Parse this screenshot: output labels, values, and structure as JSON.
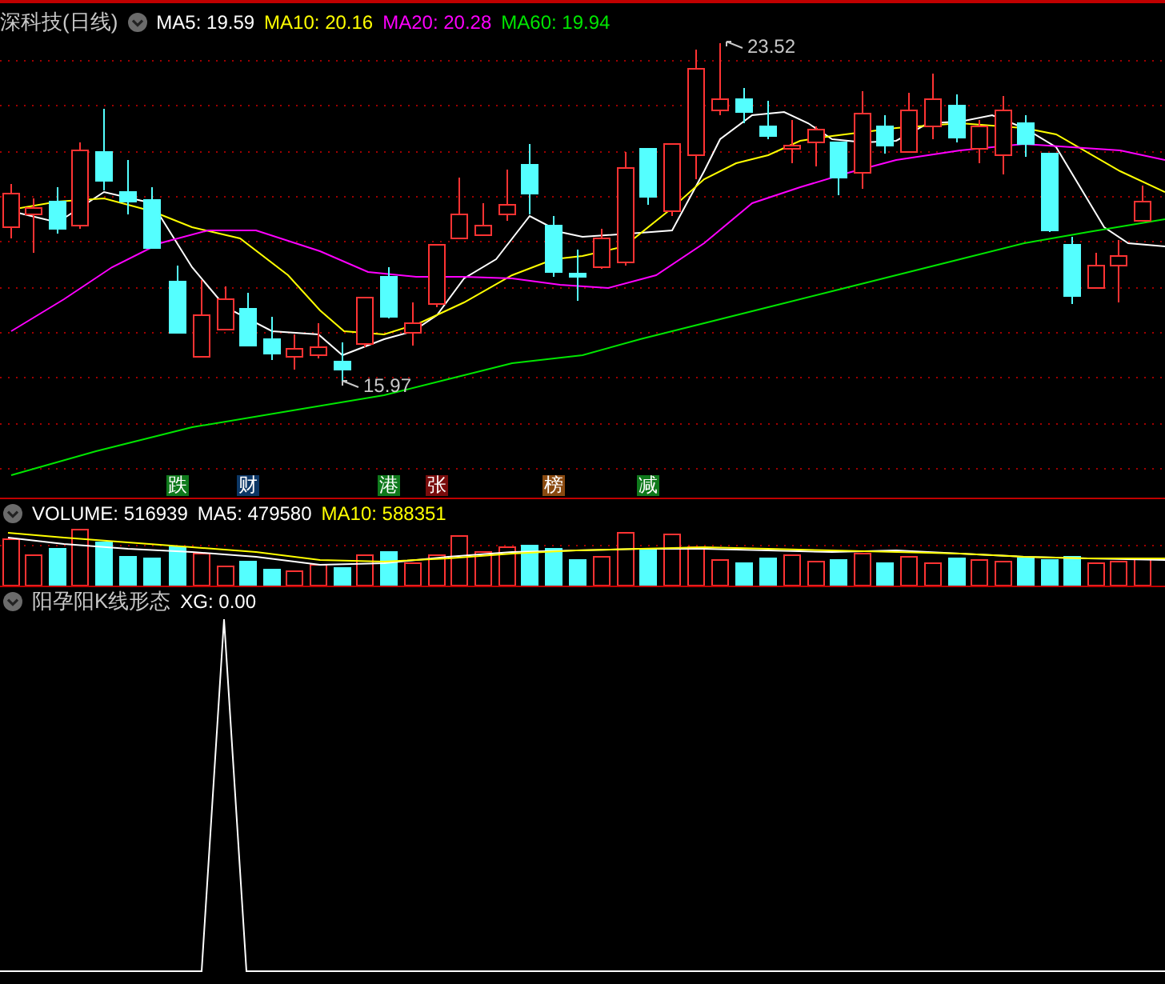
{
  "header": {
    "title": "深科技(日线)",
    "ma": [
      {
        "label": "MA5: 19.59",
        "color": "#ffffff"
      },
      {
        "label": "MA10: 20.16",
        "color": "#ffff00"
      },
      {
        "label": "MA20: 20.28",
        "color": "#ff00ff"
      },
      {
        "label": "MA60: 19.94",
        "color": "#00e600"
      }
    ]
  },
  "price_chart": {
    "high_label": "23.52",
    "low_label": "15.97",
    "markers": [
      {
        "text": "跌",
        "color": "#0f7a1c"
      },
      {
        "text": "财",
        "color": "#0c3766"
      },
      {
        "text": "港",
        "color": "#0f7a1c"
      },
      {
        "text": "张",
        "color": "#7a0c0c"
      },
      {
        "text": "榜",
        "color": "#8a4a10"
      },
      {
        "text": "减",
        "color": "#0f7a1c"
      }
    ]
  },
  "volume": {
    "readings": [
      {
        "label": "VOLUME: 516939",
        "color": "#ffffff"
      },
      {
        "label": "MA5: 479580",
        "color": "#ffffff"
      },
      {
        "label": "MA10: 588351",
        "color": "#ffff00"
      }
    ]
  },
  "indicator": {
    "title": "阳孕阳K线形态",
    "reading": "XG: 0.00"
  }
}
